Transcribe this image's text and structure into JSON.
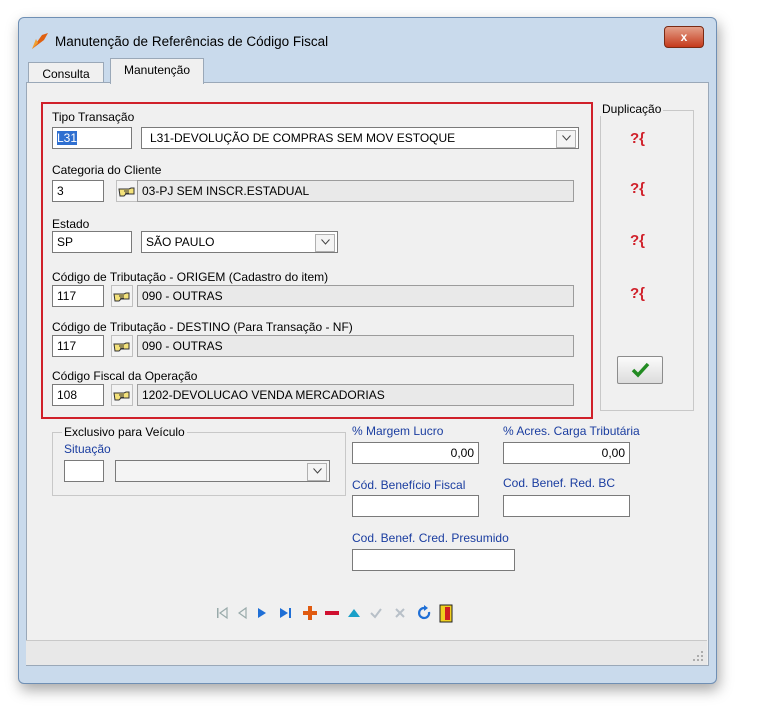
{
  "window": {
    "title": "Manutenção de Referências de Código Fiscal",
    "close_label": "x"
  },
  "tabs": [
    {
      "label": "Consulta"
    },
    {
      "label": "Manutenção"
    }
  ],
  "form": {
    "tipo_transacao": {
      "label": "Tipo Transação",
      "code": "L31",
      "description": "L31-DEVOLUÇÃO DE COMPRAS SEM MOV ESTOQUE"
    },
    "categoria_cliente": {
      "label": "Categoria do Cliente",
      "code": "3",
      "description": "03-PJ SEM INSCR.ESTADUAL"
    },
    "estado": {
      "label": "Estado",
      "code": "SP",
      "description": "SÃO PAULO"
    },
    "trib_origem": {
      "label": "Código de Tributação - ORIGEM (Cadastro do item)",
      "code": "117",
      "description": "090 -  OUTRAS"
    },
    "trib_destino": {
      "label": "Código de Tributação - DESTINO (Para Transação - NF)",
      "code": "117",
      "description": "090 -  OUTRAS"
    },
    "cfop": {
      "label": "Código Fiscal da Operação",
      "code": "108",
      "description": "1202-DEVOLUCAO VENDA MERCADORIAS"
    }
  },
  "duplicacao": {
    "label": "Duplicação",
    "button_text": "?{"
  },
  "veiculo": {
    "group_label": "Exclusivo para Veículo",
    "situacao_label": "Situação",
    "situacao_code": "",
    "situacao_value": ""
  },
  "extra": {
    "margem_label": "% Margem Lucro",
    "margem_value": "0,00",
    "acres_label": "% Acres. Carga Tributária",
    "acres_value": "0,00",
    "benef_fiscal_label": "Cód. Benefício Fiscal",
    "benef_fiscal_value": "",
    "benef_red_label": "Cod. Benef. Red. BC",
    "benef_red_value": "",
    "benef_cred_label": "Cod. Benef. Cred. Presumido",
    "benef_cred_value": ""
  },
  "colors": {
    "accent_red": "#d0202a",
    "label_blue": "#1a3da0",
    "nav_blue": "#1f6fd6"
  },
  "icons": [
    "app-logo-icon",
    "pointing-hand-icon",
    "combo-arrow-icon",
    "duplicate-icon",
    "checkmark-icon",
    "first-record-icon",
    "prior-record-icon",
    "next-record-icon",
    "last-record-icon",
    "insert-icon",
    "delete-icon",
    "edit-icon",
    "post-icon",
    "cancel-icon",
    "refresh-icon",
    "exit-door-icon"
  ]
}
